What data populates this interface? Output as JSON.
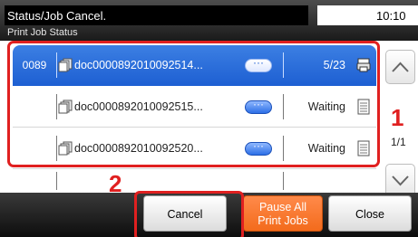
{
  "header": {
    "title": "Status/Job Cancel.",
    "time": "10:10",
    "subtitle": "Print Job Status"
  },
  "jobs": [
    {
      "id": "0089",
      "name": "doc0000892010092514...",
      "status": "5/23",
      "selected": true
    },
    {
      "id": "",
      "name": "doc0000892010092515...",
      "status": "Waiting",
      "selected": false
    },
    {
      "id": "",
      "name": "doc0000892010092520...",
      "status": "Waiting",
      "selected": false
    }
  ],
  "pagination": {
    "indicator": "1/1"
  },
  "annotations": {
    "one": "1",
    "two": "2"
  },
  "buttons": {
    "cancel": "Cancel",
    "pause_line1": "Pause All",
    "pause_line2": "Print Jobs",
    "close": "Close"
  },
  "colors": {
    "selected_row": "#1d5fd2",
    "pause_button": "#f36b1c",
    "annotation": "#e02020"
  },
  "icons": {
    "doc": "document-stack-icon",
    "details": "details-ellipsis-icon",
    "printing": "printer-active-icon",
    "waiting": "document-waiting-icon",
    "up": "chevron-up-icon",
    "down": "chevron-down-icon"
  }
}
